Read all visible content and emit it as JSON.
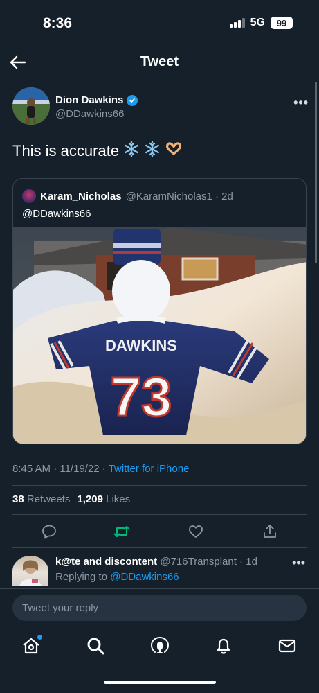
{
  "status_bar": {
    "time": "8:36",
    "network": "5G",
    "battery": "99"
  },
  "header": {
    "title": "Tweet"
  },
  "tweet": {
    "author_name": "Dion Dawkins",
    "author_handle": "@DDawkins66",
    "text": "This is accurate",
    "emojis": [
      "❄️",
      "❄️",
      "🫶"
    ],
    "timestamp": "8:45 AM · 11/19/22 · ",
    "source": "Twitter for iPhone",
    "retweets_count": "38",
    "retweets_label": "Retweets",
    "likes_count": "1,209",
    "likes_label": "Likes"
  },
  "quote": {
    "author_name": "Karam_Nicholas",
    "author_handle": "@KaramNicholas1 · 2d",
    "text": "@DDawkins66",
    "jersey_name": "DAWKINS",
    "jersey_number": "73"
  },
  "reply": {
    "author_name": "k@te and discontent",
    "author_handle": "@716Transplant · 1d",
    "replying_to_label": "Replying to",
    "replying_to_handle": "@DDawkins66"
  },
  "composer": {
    "placeholder": "Tweet your reply"
  },
  "colors": {
    "background": "#15202b",
    "accent": "#1d9bf0",
    "retweet": "#00ba7c",
    "muted": "#8b98a5",
    "border": "#38444d"
  },
  "icons": {
    "actions": [
      "reply-icon",
      "retweet-icon",
      "like-icon",
      "share-icon"
    ],
    "tabs": [
      "home-icon",
      "search-icon",
      "spaces-icon",
      "notifications-icon",
      "messages-icon"
    ]
  }
}
